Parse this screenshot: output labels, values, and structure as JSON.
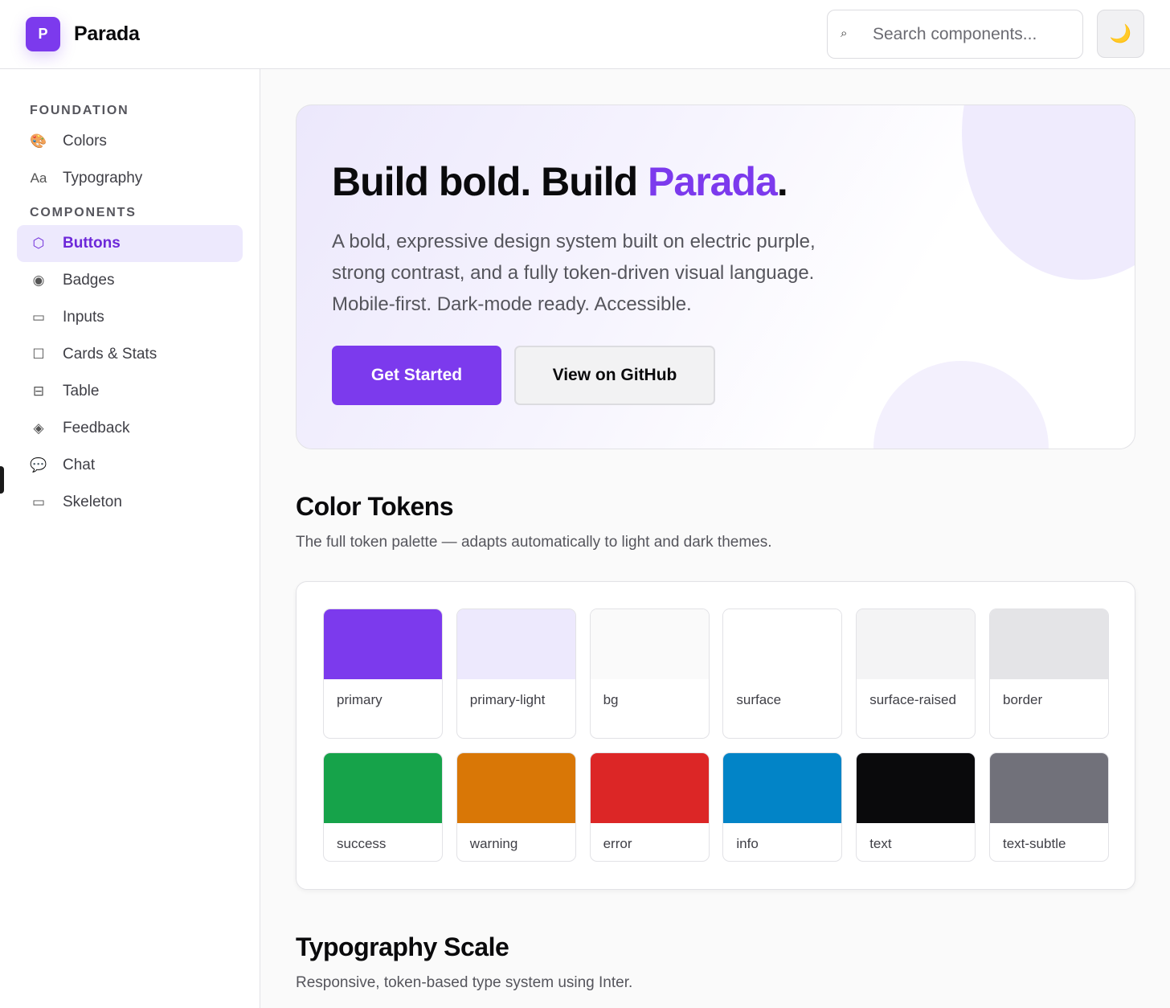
{
  "header": {
    "logo_letter": "P",
    "brand": "Parada",
    "search_placeholder": "Search components...",
    "search_icon": "⌕",
    "theme_icon": "🌙"
  },
  "sidebar": {
    "foundation_heading": "FOUNDATION",
    "components_heading": "COMPONENTS",
    "foundation_items": [
      {
        "label": "Colors",
        "icon": "🎨"
      },
      {
        "label": "Typography",
        "icon": "Aa"
      }
    ],
    "component_items": [
      {
        "label": "Buttons",
        "icon": "⬡",
        "active": true
      },
      {
        "label": "Badges",
        "icon": "◉"
      },
      {
        "label": "Inputs",
        "icon": "▭"
      },
      {
        "label": "Cards & Stats",
        "icon": "☐"
      },
      {
        "label": "Table",
        "icon": "⊟"
      },
      {
        "label": "Feedback",
        "icon": "◈"
      },
      {
        "label": "Chat",
        "icon": "💬"
      },
      {
        "label": "Skeleton",
        "icon": "▭"
      }
    ]
  },
  "hero": {
    "title_prefix": "Build bold. Build ",
    "title_accent": "Parada",
    "title_suffix": ".",
    "description": "A bold, expressive design system built on electric purple, strong contrast, and a fully token-driven visual language. Mobile-first. Dark-mode ready. Accessible.",
    "primary_button": "Get Started",
    "secondary_button": "View on GitHub"
  },
  "color_section": {
    "title": "Color Tokens",
    "subtitle": "The full token palette — adapts automatically to light and dark themes.",
    "swatches": [
      {
        "name": "primary",
        "color": "#7c3aed"
      },
      {
        "name": "primary-light",
        "color": "#ede9fd"
      },
      {
        "name": "bg",
        "color": "#fafafa"
      },
      {
        "name": "surface",
        "color": "#ffffff"
      },
      {
        "name": "surface-raised",
        "color": "#f4f4f5"
      },
      {
        "name": "border",
        "color": "#e4e4e7"
      },
      {
        "name": "success",
        "color": "#16a34a"
      },
      {
        "name": "warning",
        "color": "#d97706"
      },
      {
        "name": "error",
        "color": "#dc2626"
      },
      {
        "name": "info",
        "color": "#0284c7"
      },
      {
        "name": "text",
        "color": "#0a0a0c"
      },
      {
        "name": "text-subtle",
        "color": "#71717a"
      }
    ]
  },
  "typography_section": {
    "title": "Typography Scale",
    "subtitle": "Responsive, token-based type system using Inter."
  }
}
